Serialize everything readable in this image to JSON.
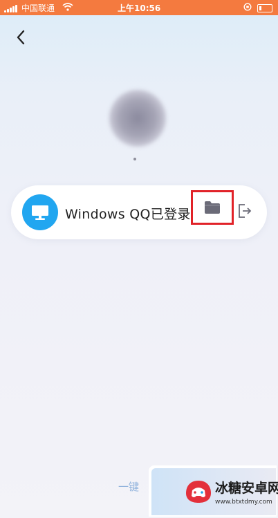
{
  "status_bar": {
    "carrier": "中国联通",
    "time": "上午10:56",
    "background_color": "#f47a3f"
  },
  "nav": {
    "back_icon": "chevron-left-icon"
  },
  "device": {
    "label": "Windows QQ已登录",
    "icon": "monitor-icon",
    "icon_bg": "#21a6f0",
    "files_icon": "folder-icon",
    "highlight_color": "#e12228",
    "logout_icon": "logout-icon"
  },
  "footer": {
    "link_partial": "一键"
  },
  "watermark": {
    "title": "冰糖安卓网",
    "url": "www.btxtdmy.com"
  }
}
